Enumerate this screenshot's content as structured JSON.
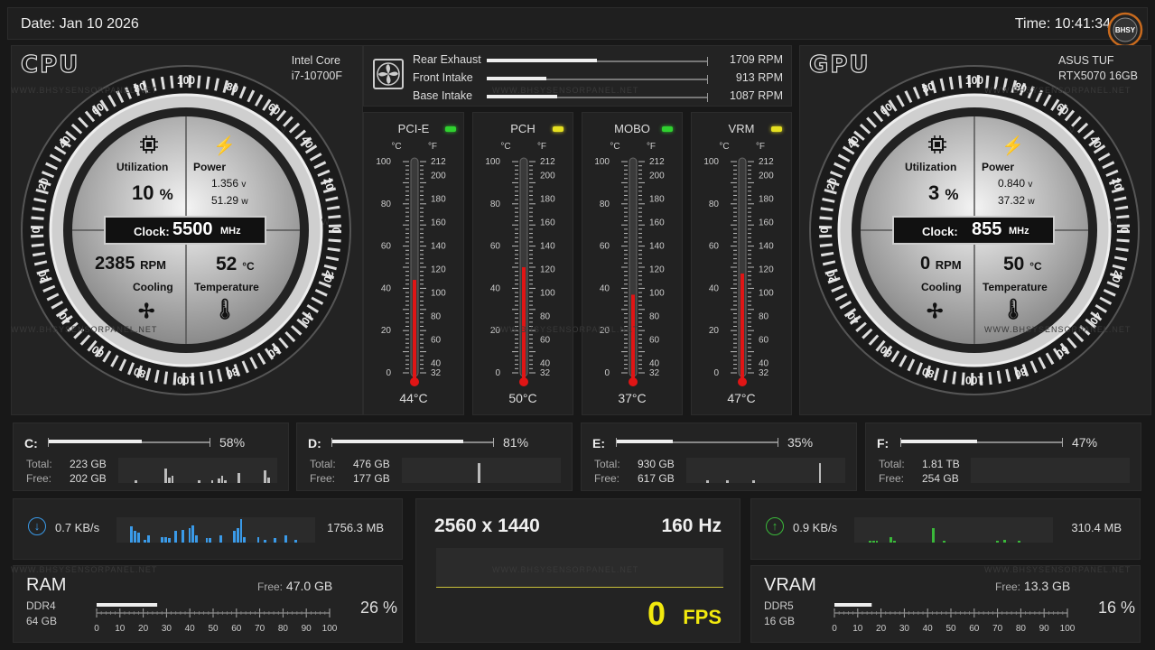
{
  "header": {
    "date": "Date: Jan 10 2026",
    "time": "Time: 10:41:34",
    "logo": "BHSY"
  },
  "watermark": "WWW.BHSYSENSORPANEL.NET",
  "cpu": {
    "tag": "CPU",
    "model_line1": "Intel Core",
    "model_line2": "i7-10700F",
    "utilization_label": "Utilization",
    "utilization_value": "10",
    "utilization_unit": "%",
    "power_label": "Power",
    "voltage": "1.356",
    "voltage_unit": "v",
    "watts": "51.29",
    "watts_unit": "w",
    "clock_label": "Clock:",
    "clock_value": "5500",
    "clock_unit": "MHz",
    "fan_value": "2385",
    "fan_unit": "RPM",
    "cooling_label": "Cooling",
    "temp_value": "52",
    "temp_unit": "°C",
    "temp_label": "Temperature"
  },
  "gpu": {
    "tag": "GPU",
    "model_line1": "ASUS TUF",
    "model_line2": "RTX5070 16GB",
    "utilization_label": "Utilization",
    "utilization_value": "3",
    "utilization_unit": "%",
    "power_label": "Power",
    "voltage": "0.840",
    "voltage_unit": "v",
    "watts": "37.32",
    "watts_unit": "w",
    "clock_label": "Clock:",
    "clock_value": "855",
    "clock_unit": "MHz",
    "fan_value": "0",
    "fan_unit": "RPM",
    "cooling_label": "Cooling",
    "temp_value": "50",
    "temp_unit": "°C",
    "temp_label": "Temperature"
  },
  "gauge_scale": {
    "top_labels": [
      "80",
      "60",
      "40",
      "20",
      "0",
      "100"
    ],
    "bottom_labels": [
      "20",
      "40",
      "60",
      "80",
      "100"
    ],
    "right_labels": [
      "80",
      "60",
      "40",
      "20",
      "0"
    ],
    "v_label": "V",
    "w_label": "W"
  },
  "fans": [
    {
      "name": "Rear Exhaust",
      "value": "1709 RPM",
      "level": 0.5
    },
    {
      "name": "Front Intake",
      "value": "913 RPM",
      "level": 0.27
    },
    {
      "name": "Base Intake",
      "value": "1087 RPM",
      "level": 0.32
    }
  ],
  "thermometers": {
    "c_unit": "°C",
    "f_unit": "°F",
    "c_ticks": [
      "100",
      "80",
      "60",
      "40",
      "20",
      "0"
    ],
    "f_ticks": [
      "212",
      "200",
      "180",
      "160",
      "140",
      "120",
      "100",
      "80",
      "60",
      "40",
      "32"
    ],
    "sensors": [
      {
        "name": "PCI-E",
        "value": "44°C",
        "temp": 44,
        "led": "#2fd12f"
      },
      {
        "name": "PCH",
        "value": "50°C",
        "temp": 50,
        "led": "#e6e020"
      },
      {
        "name": "MOBO",
        "value": "37°C",
        "temp": 37,
        "led": "#2fd12f"
      },
      {
        "name": "VRM",
        "value": "47°C",
        "temp": 47,
        "led": "#e6e020"
      }
    ]
  },
  "drives": [
    {
      "letter": "C:",
      "percent": "58%",
      "used": 0.58,
      "total_label": "Total:",
      "total": "223 GB",
      "free_label": "Free:",
      "free": "202 GB"
    },
    {
      "letter": "D:",
      "percent": "81%",
      "used": 0.81,
      "total_label": "Total:",
      "total": "476 GB",
      "free_label": "Free:",
      "free": "177 GB"
    },
    {
      "letter": "E:",
      "percent": "35%",
      "used": 0.35,
      "total_label": "Total:",
      "total": "930 GB",
      "free_label": "Free:",
      "free": "617 GB"
    },
    {
      "letter": "F:",
      "percent": "47%",
      "used": 0.47,
      "total_label": "Total:",
      "total": "1.81 TB",
      "free_label": "Free:",
      "free": "254 GB"
    }
  ],
  "network": {
    "download": {
      "rate": "0.7 KB/s",
      "total": "1756.3 MB",
      "color": "#3a9ae8"
    },
    "upload": {
      "rate": "0.9 KB/s",
      "total": "310.4 MB",
      "color": "#3ab83a"
    }
  },
  "ram": {
    "title": "RAM",
    "type": "DDR4",
    "size": "64 GB",
    "free_label": "Free:",
    "free": "47.0 GB",
    "percent": "26 %",
    "level": 0.26
  },
  "vram": {
    "title": "VRAM",
    "type": "DDR5",
    "size": "16 GB",
    "free_label": "Free:",
    "free": "13.3 GB",
    "percent": "16 %",
    "level": 0.16
  },
  "scale_labels": [
    "0",
    "10",
    "20",
    "30",
    "40",
    "50",
    "60",
    "70",
    "80",
    "90",
    "100"
  ],
  "display": {
    "resolution": "2560 x 1440",
    "refresh": "160 Hz",
    "fps": "0",
    "fps_label": "FPS"
  },
  "colors": {
    "accent_yellow": "#f2e90e",
    "thermo_red": "#e01515"
  }
}
